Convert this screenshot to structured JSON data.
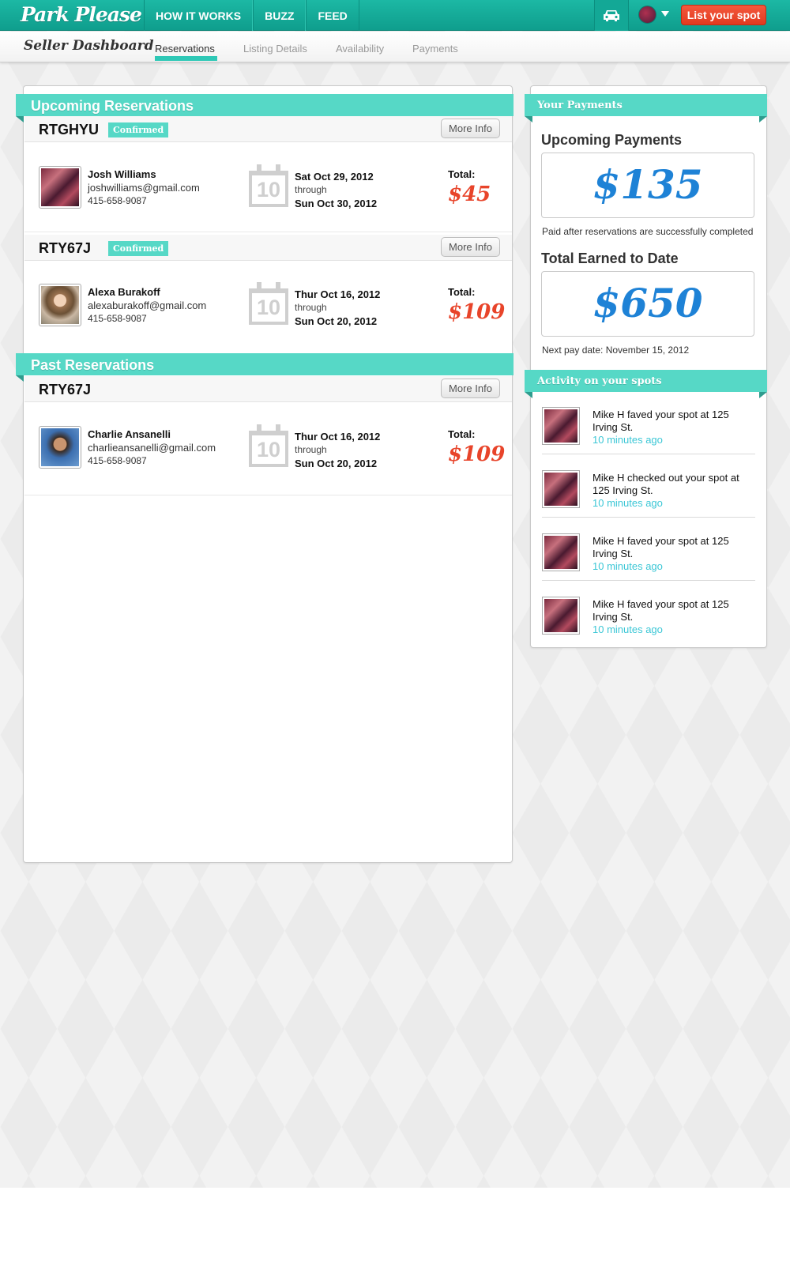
{
  "nav": {
    "logo": "Park Please",
    "links": [
      "HOW IT WORKS",
      "BUZZ",
      "FEED"
    ],
    "list_spot": "List your spot"
  },
  "subnav": {
    "title": "Seller Dashboard",
    "tabs": [
      "Reservations",
      "Listing Details",
      "Availability",
      "Payments"
    ],
    "active_tab": "Reservations"
  },
  "reservations": {
    "upcoming_title": "Upcoming Reservations",
    "past_title": "Past Reservations",
    "upcoming": [
      {
        "id": "RTGHYU",
        "status": "Confirmed",
        "more_info": "More Info",
        "name": "Josh Williams",
        "email": "joshwilliams@gmail.com",
        "phone": "415-658-9087",
        "cal_day": "10",
        "from": "Sat Oct 29, 2012",
        "through": "through",
        "to": "Sun Oct 30, 2012",
        "total_label": "Total:",
        "total": "$45"
      },
      {
        "id": "RTY67J",
        "status": "Confirmed",
        "more_info": "More Info",
        "name": "Alexa Burakoff",
        "email": "alexaburakoff@gmail.com",
        "phone": "415-658-9087",
        "cal_day": "10",
        "from": "Thur Oct 16, 2012",
        "through": "through",
        "to": "Sun Oct 20, 2012",
        "total_label": "Total:",
        "total": "$109"
      }
    ],
    "past": [
      {
        "id": "RTY67J",
        "more_info": "More Info",
        "name": "Charlie Ansanelli",
        "email": "charlieansanelli@gmail.com",
        "phone": "415-658-9087",
        "cal_day": "10",
        "from": "Thur Oct 16, 2012",
        "through": "through",
        "to": "Sun Oct 20, 2012",
        "total_label": "Total:",
        "total": "$109"
      }
    ]
  },
  "payments": {
    "title": "Your Payments",
    "upcoming_label": "Upcoming Payments",
    "upcoming_amount": "$135",
    "upcoming_note": "Paid after reservations are successfully completed",
    "earned_label": "Total Earned to Date",
    "earned_amount": "$650",
    "next_pay": "Next pay date: November 15, 2012"
  },
  "activity": {
    "title": "Activity on your spots",
    "items": [
      {
        "text": "Mike H faved your spot at 125 Irving St.",
        "time": "10 minutes ago"
      },
      {
        "text": "Mike H checked out your spot at 125 Irving St.",
        "time": "10 minutes ago"
      },
      {
        "text": "Mike H faved your spot at 125 Irving St.",
        "time": "10 minutes ago"
      },
      {
        "text": "Mike H faved your spot at 125 Irving St.",
        "time": "10 minutes ago"
      }
    ]
  },
  "colors": {
    "brand_teal": "#1cb8a4",
    "ribbon": "#56d8c6",
    "accent_red": "#e8442a",
    "money_blue": "#1e82d6",
    "time_cyan": "#3cc7d6"
  }
}
